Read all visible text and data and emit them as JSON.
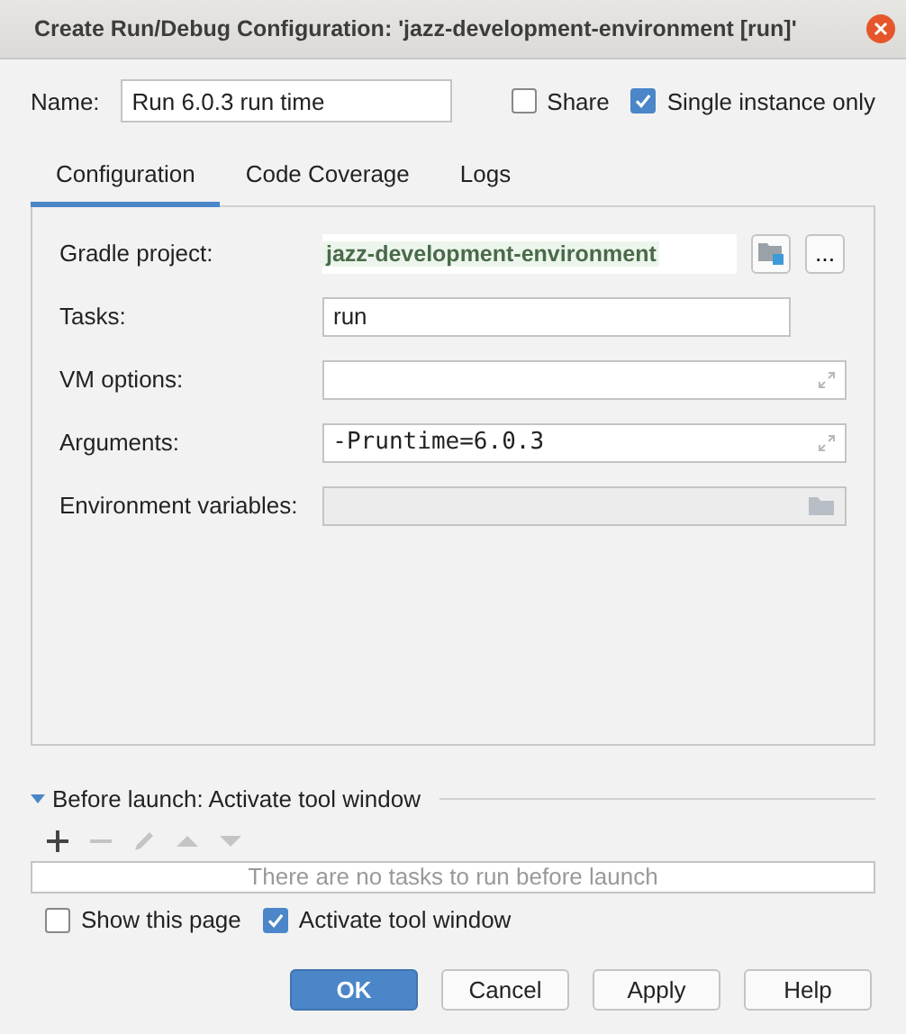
{
  "window": {
    "title": "Create Run/Debug Configuration: 'jazz-development-environment [run]'"
  },
  "name_field": {
    "label": "Name:",
    "value": "Run 6.0.3 run time"
  },
  "header_options": [
    {
      "label": "Share",
      "checked": false
    },
    {
      "label": "Single instance only",
      "checked": true
    }
  ],
  "tabs": [
    {
      "label": "Configuration",
      "selected": true
    },
    {
      "label": "Code Coverage",
      "selected": false
    },
    {
      "label": "Logs",
      "selected": false
    }
  ],
  "fields": [
    {
      "kind": "project",
      "label": "Gradle project:",
      "value": "jazz-development-environment",
      "browse_label": "..."
    },
    {
      "kind": "text",
      "label": "Tasks:",
      "value": "run"
    },
    {
      "kind": "expand",
      "label": "VM options:"
    },
    {
      "kind": "expand",
      "label": "Arguments:",
      "value": "-Pruntime=6.0.3"
    },
    {
      "kind": "env",
      "label": "Environment variables:",
      "disabled": true
    }
  ],
  "before_launch": {
    "title": "Before launch: Activate tool window",
    "expanded": true,
    "tools": [
      {
        "kind": "add",
        "disabled": false
      },
      {
        "kind": "remove",
        "disabled": true
      },
      {
        "kind": "edit",
        "disabled": true
      },
      {
        "kind": "up",
        "disabled": true
      },
      {
        "kind": "down",
        "disabled": true
      }
    ],
    "empty_text": "There are no tasks to run before launch"
  },
  "options": [
    {
      "label": "Show this page",
      "checked": false
    },
    {
      "label": "Activate tool window",
      "checked": true
    }
  ],
  "buttons": [
    {
      "label": "OK",
      "kind": "primary"
    },
    {
      "label": "Cancel",
      "kind": "default"
    },
    {
      "label": "Apply",
      "kind": "default"
    },
    {
      "label": "Help",
      "kind": "default"
    }
  ]
}
